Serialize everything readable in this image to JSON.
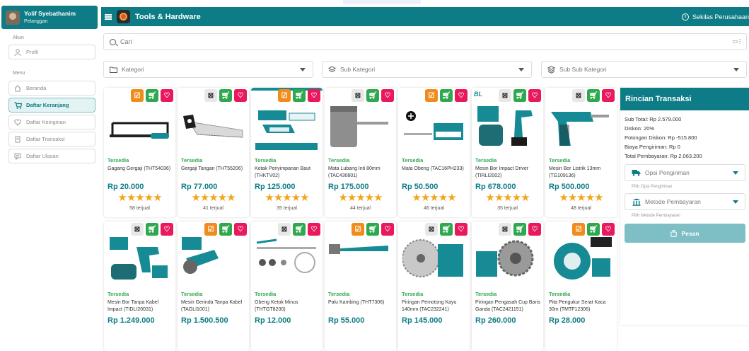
{
  "app": {
    "title": "Tools & Hardware",
    "company_link": "Sekilas Perusahaan",
    "accent": "#0e7c86"
  },
  "user": {
    "name": "Yolif Syebathanim",
    "role": "Pelanggan"
  },
  "sidebar": {
    "account_label": "Akun",
    "menu_label": "Menu",
    "profile": "Profil",
    "items": [
      {
        "label": "Beranda",
        "icon": "home-icon",
        "active": false
      },
      {
        "label": "Daftar Keranjang",
        "icon": "cart-icon",
        "active": true
      },
      {
        "label": "Daftar Keinginan",
        "icon": "heart-icon",
        "active": false
      },
      {
        "label": "Daftar Transaksi",
        "icon": "receipt-icon",
        "active": false
      },
      {
        "label": "Daftar Ulasan",
        "icon": "review-icon",
        "active": false
      }
    ]
  },
  "search": {
    "placeholder": "Cari"
  },
  "filters": {
    "category": "Kategori",
    "sub_category": "Sub Kategori",
    "sub_sub_category": "Sub Sub Kategori"
  },
  "products": [
    {
      "name": "Gagang Gergaji (THT54036)",
      "price": "Rp 20.000",
      "stock": "Tersedia",
      "sold": "58 terjual",
      "compared": true
    },
    {
      "name": "Gergaji Tangan (THT55206)",
      "price": "Rp 77.000",
      "stock": "Tersedia",
      "sold": "41 terjual",
      "compared": false
    },
    {
      "name": "Kotak Penyimpanan Baut (THKTV02)",
      "price": "Rp 125.000",
      "stock": "Tersedia",
      "sold": "35 terjual",
      "compared": true
    },
    {
      "name": "Mata Lubang Inti 80mm (TAC430801)",
      "price": "Rp 175.000",
      "stock": "Tersedia",
      "sold": "44 terjual",
      "compared": false
    },
    {
      "name": "Mata Obeng (TAC16PH233)",
      "price": "Rp 50.500",
      "stock": "Tersedia",
      "sold": "46 terjual",
      "compared": true
    },
    {
      "name": "Mesin Bor Impact Driver (TIRLI2002)",
      "price": "Rp 678.000",
      "stock": "Tersedia",
      "sold": "35 terjual",
      "compared": false
    },
    {
      "name": "Mesin Bor Listrik 13mm (TG109136)",
      "price": "Rp 500.000",
      "stock": "Tersedia",
      "sold": "48 terjual",
      "compared": false
    },
    {
      "name": "Mesin Bor Tanpa Kabel Impact (TIDLI20031)",
      "price": "Rp 1.249.000",
      "stock": "Tersedia",
      "sold": "",
      "compared": false
    },
    {
      "name": "Mesin Gerinda Tanpa Kabel (TAGLI1001)",
      "price": "Rp 1.500.500",
      "stock": "Tersedia",
      "sold": "",
      "compared": true
    },
    {
      "name": "Obeng Ketok Minus (THTGT8200)",
      "price": "Rp 12.000",
      "stock": "Tersedia",
      "sold": "",
      "compared": false
    },
    {
      "name": "Palu Kambing (THT7306)",
      "price": "Rp 55.000",
      "stock": "Tersedia",
      "sold": "",
      "compared": true
    },
    {
      "name": "Piringan Pemotong Kayu 140mm (TAC232241)",
      "price": "Rp 145.000",
      "stock": "Tersedia",
      "sold": "",
      "compared": false
    },
    {
      "name": "Piringan Pengasah Cup Baris Ganda (TAC2421151)",
      "price": "Rp 260.000",
      "stock": "Tersedia",
      "sold": "",
      "compared": false
    },
    {
      "name": "Pita Pengukur Serat Kaca 30m (TMTF12306)",
      "price": "Rp 28.000",
      "stock": "Tersedia",
      "sold": "",
      "compared": true
    }
  ],
  "transaction": {
    "title": "Rincian Transaksi",
    "subtotal": "Sub Total: Rp 2.579.000",
    "discount": "Diskon: 20%",
    "discount_cut": "Potongan Diskon: Rp -515.800",
    "shipping_cost": "Biaya Pengiriman: Rp 0",
    "total": "Total Pembayaran: Rp 2.063.200",
    "shipping_select": "Opsi Pengiriman",
    "shipping_hint": "Pilih Opsi Pengiriman",
    "payment_select": "Metode Pembayaran",
    "payment_hint": "Pilih Metode Pembayaran",
    "order_button": "Pesan"
  }
}
